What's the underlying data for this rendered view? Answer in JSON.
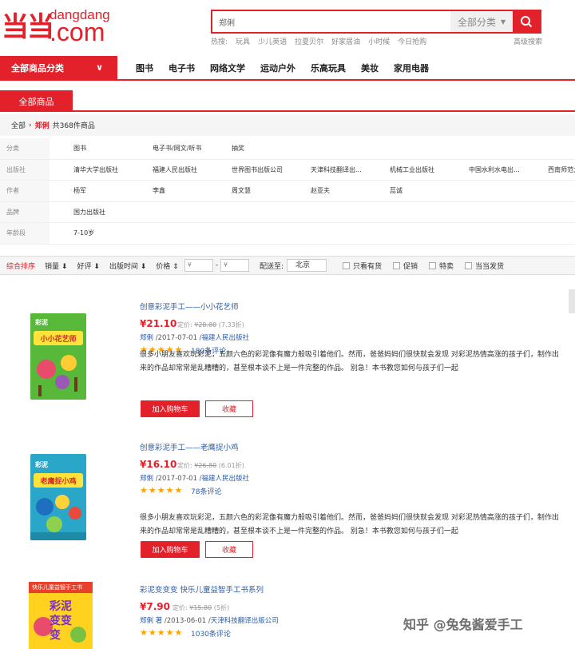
{
  "header": {
    "logo_cn": "当当",
    "logo_en_small": "dangdang",
    "logo_en_big": ".com",
    "search_value": "郑俐",
    "search_category": "全部分类",
    "hot_label": "热搜:",
    "hot_terms": [
      "玩具",
      "少儿英语",
      "拉夏贝尔",
      "好家居油",
      "小时候",
      "今日抢购"
    ],
    "advanced_search": "高级搜索"
  },
  "nav": {
    "all_categories": "全部商品分类",
    "items": [
      "图书",
      "电子书",
      "网络文学",
      "运动户外",
      "乐高玩具",
      "美妆",
      "家用电器"
    ]
  },
  "tab": {
    "label": "全部商品"
  },
  "breadcrumb": {
    "root": "全部",
    "keyword": "郑俐",
    "count_text": "共368件商品"
  },
  "filters": [
    {
      "label": "分类",
      "values": [
        "图书",
        "电子书/网文/听书",
        "抽奖"
      ]
    },
    {
      "label": "出版社",
      "values": [
        "清华大学出版社",
        "福建人民出版社",
        "世界图书出版公司",
        "天津科技翻译出...",
        "机械工业出版社",
        "中国水利水电出...",
        "西南师范大..."
      ]
    },
    {
      "label": "作者",
      "values": [
        "杨军",
        "李鑫",
        "周文慧",
        "赵亚夫",
        "蕊诚"
      ]
    },
    {
      "label": "品牌",
      "values": [
        "国力出版社"
      ]
    },
    {
      "label": "年龄段",
      "values": [
        "7-10岁"
      ]
    }
  ],
  "sortbar": {
    "sorts": [
      "综合排序",
      "销量",
      "好评",
      "出版时间",
      "价格"
    ],
    "price_min": "¥",
    "price_max": "¥",
    "dest_label": "配送至:",
    "dest_value": "北京",
    "checkboxes": [
      "只看有货",
      "促销",
      "特卖",
      "当当发货"
    ]
  },
  "products": [
    {
      "title": "创意彩泥手工——小小花艺师",
      "price": "¥21.10",
      "orig_label": "定价:",
      "orig_price": "¥28.80",
      "discount": "(7.33折)",
      "author": "郑俐",
      "date": "/2017-07-01 /",
      "publisher": "福建人民出版社",
      "reviews": "180条评论",
      "desc": "很多小朋友喜欢玩彩泥，五颜六色的彩泥像有魔力般吸引着他们。然而，爸爸妈妈们很快就会发现 对彩泥热情高涨的孩子们，制作出来的作品却常常是乱糟糟的，甚至根本谈不上是一件完整的作品。 别急！本书教您如何与孩子们一起",
      "cart": "加入购物车",
      "fav": "收藏",
      "cover_text1": "彩泥",
      "cover_text2": "小小花艺师"
    },
    {
      "title": "创意彩泥手工——老鹰捉小鸡",
      "price": "¥16.10",
      "orig_label": "定价:",
      "orig_price": "¥26.80",
      "discount": "(6.01折)",
      "author": "郑俐",
      "date": "/2017-07-01 /",
      "publisher": "福建人民出版社",
      "reviews": "78条评论",
      "desc": "很多小朋友喜欢玩彩泥，五颜六色的彩泥像有魔力般吸引着他们。然而，爸爸妈妈们很快就会发现 对彩泥热情高涨的孩子们，制作出来的作品却常常是乱糟糟的，甚至根本谈不上是一件完整的作品。 别急！本书教您如何与孩子们一起",
      "cart": "加入购物车",
      "fav": "收藏",
      "cover_text1": "彩泥",
      "cover_text2": "老鹰捉小鸡"
    },
    {
      "title": "彩泥变变变 快乐儿童益智手工书系列",
      "price": "¥7.90",
      "orig_label": "定价:",
      "orig_price": "¥15.80",
      "discount": "(5折)",
      "author": "郑俐 著",
      "date": "/2013-06-01 /",
      "publisher": "天津科技翻译出版公司",
      "reviews": "1030条评论",
      "cover_text1": "快乐儿童益智手工书",
      "cover_text2": "彩泥变变变"
    }
  ],
  "watermark": "知乎 @兔兔酱爱手工",
  "colors": {
    "brand": "#e3212b",
    "link": "#2b5daa",
    "star": "#ffa200"
  }
}
